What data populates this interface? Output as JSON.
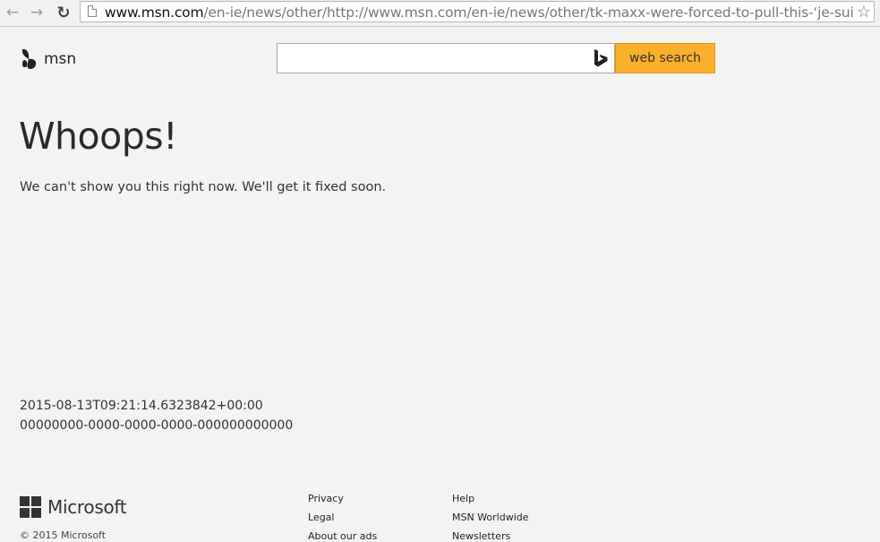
{
  "browser": {
    "url_host": "www.msn.com",
    "url_path": "/en-ie/news/other/http://www.msn.com/en-ie/news/other/tk-maxx-were-forced-to-pull-this-‘je-suis-ove"
  },
  "header": {
    "logo_text": "msn",
    "search_placeholder": "",
    "search_button_label": "web search"
  },
  "main": {
    "heading": "Whoops!",
    "message": "We can't show you this right now. We'll get it fixed soon.",
    "timestamp": "2015-08-13T09:21:14.6323842+00:00",
    "request_id": "00000000-0000-0000-0000-000000000000"
  },
  "footer": {
    "brand": "Microsoft",
    "copyright": "© 2015 Microsoft",
    "col1": [
      "Privacy",
      "Legal",
      "About our ads"
    ],
    "col2": [
      "Help",
      "MSN Worldwide",
      "Newsletters"
    ]
  },
  "colors": {
    "search_button": "#fbb02c",
    "page_background": "#f3f3f1"
  }
}
